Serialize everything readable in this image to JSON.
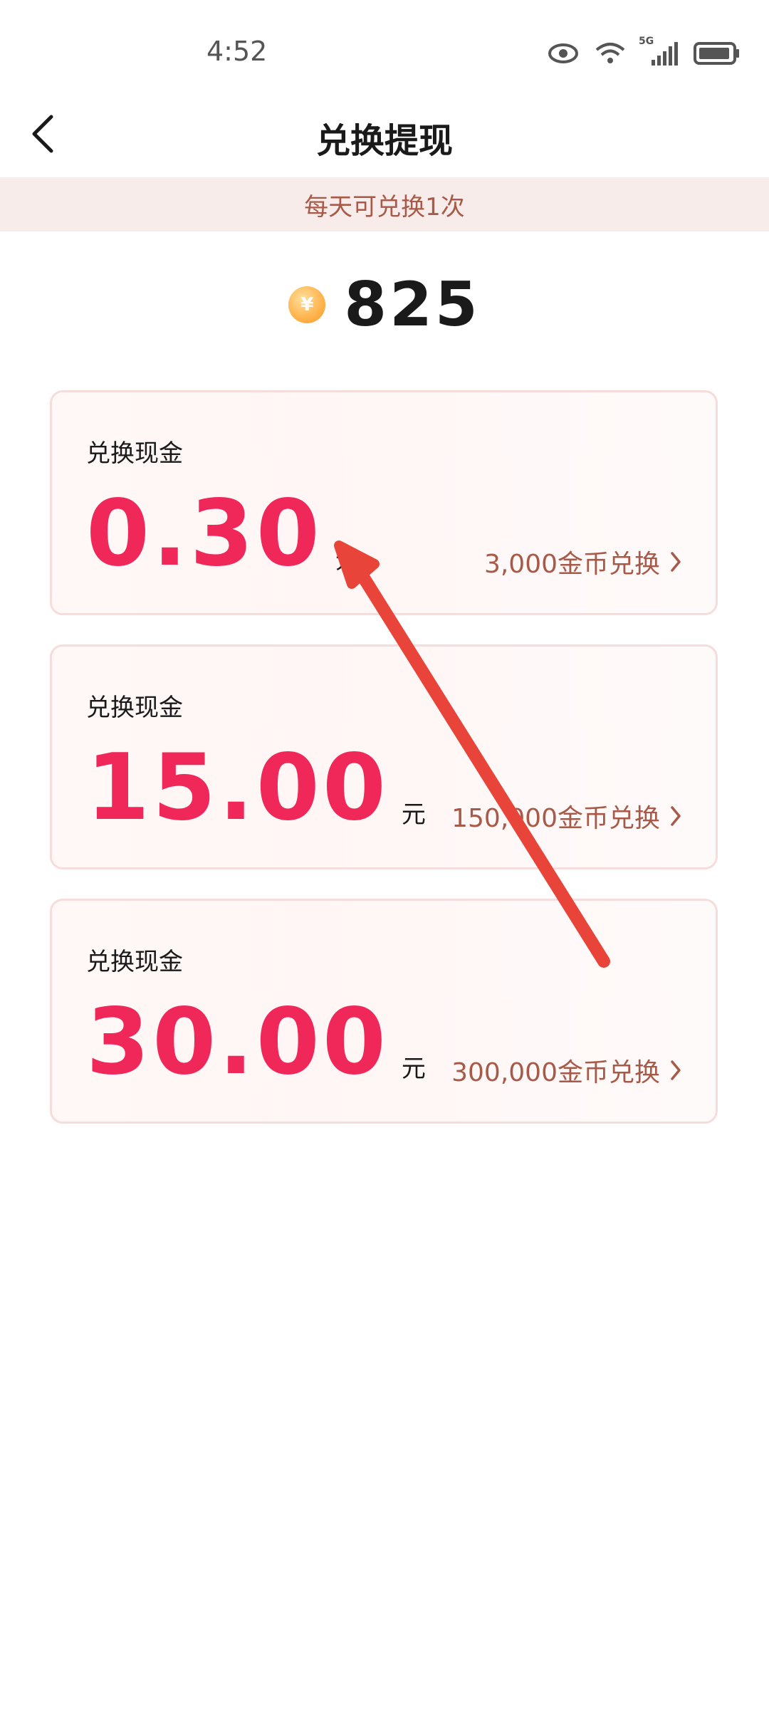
{
  "status_bar": {
    "time": "4:52",
    "icons": [
      "eye-icon",
      "wifi-icon",
      "5g-signal-icon",
      "battery-icon"
    ],
    "network_label": "5G"
  },
  "header": {
    "title": "兑换提现",
    "back_icon": "chevron-left-icon"
  },
  "notice": "每天可兑换1次",
  "balance": {
    "coin_symbol": "¥",
    "value": "825"
  },
  "options": [
    {
      "label": "兑换现金",
      "amount": "0.30",
      "unit": "元",
      "cost": "3,000金币兑换"
    },
    {
      "label": "兑换现金",
      "amount": "15.00",
      "unit": "元",
      "cost": "150,000金币兑换"
    },
    {
      "label": "兑换现金",
      "amount": "30.00",
      "unit": "元",
      "cost": "300,000金币兑换"
    }
  ],
  "colors": {
    "accent": "#f0285a",
    "notice_bg": "#f8ecea",
    "notice_text": "#a85a48",
    "annotation_arrow": "#e8443a"
  }
}
